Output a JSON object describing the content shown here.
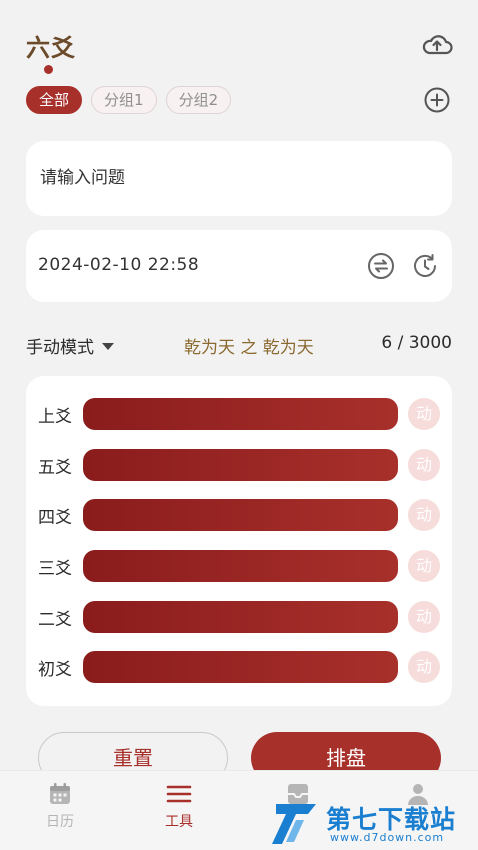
{
  "header": {
    "title": "六爻",
    "cloud_icon": "cloud-upload-icon"
  },
  "groups": [
    {
      "label": "全部",
      "active": true
    },
    {
      "label": "分组1",
      "active": false
    },
    {
      "label": "分组2",
      "active": false
    }
  ],
  "add_icon": "add-circle-icon",
  "question": {
    "placeholder": "请输入问题",
    "value": ""
  },
  "datetime": {
    "value": "2024-02-10 22:58",
    "swap_icon": "swap-icon",
    "refresh_icon": "refresh-clock-icon"
  },
  "mode": {
    "label": "手动模式",
    "gua": "乾为天 之 乾为天",
    "count": "6 / 3000"
  },
  "yao": [
    {
      "label": "上爻",
      "dong": "动"
    },
    {
      "label": "五爻",
      "dong": "动"
    },
    {
      "label": "四爻",
      "dong": "动"
    },
    {
      "label": "三爻",
      "dong": "动"
    },
    {
      "label": "二爻",
      "dong": "动"
    },
    {
      "label": "初爻",
      "dong": "动"
    }
  ],
  "actions": {
    "reset": "重置",
    "submit": "排盘"
  },
  "tabs": [
    {
      "label": "日历",
      "icon": "calendar-icon"
    },
    {
      "label": "工具",
      "icon": "menu-icon",
      "active": true
    },
    {
      "label": "",
      "icon": "inbox-icon"
    },
    {
      "label": "",
      "icon": "person-icon"
    }
  ],
  "watermark": {
    "name": "第七下载站",
    "url": "www.d7down.com"
  },
  "colors": {
    "accent": "#a8302b",
    "gold": "#8a6a30",
    "background": "#f3f2f2"
  }
}
